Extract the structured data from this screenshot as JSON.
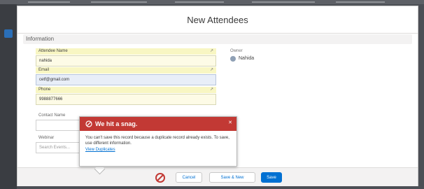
{
  "modal": {
    "title": "New Attendees"
  },
  "section": {
    "label": "Information"
  },
  "fields": [
    {
      "label": "Attendee Name",
      "value": "nahida"
    },
    {
      "label": "Email",
      "value": "cetf@gmail.com"
    },
    {
      "label": "Phone",
      "value": "9988877666"
    },
    {
      "label": "Contact Name",
      "value": ""
    },
    {
      "label": "Webinar",
      "value": "Search Events..."
    }
  ],
  "owner": {
    "label": "Owner",
    "value": "Nahida"
  },
  "popover": {
    "title": "We hit a snag.",
    "message": "You can't save this record because a duplicate record already exists. To save, use different information.",
    "link": "View Duplicates",
    "close_icon": "close-icon",
    "warning_icon": "warning-icon"
  },
  "footer": {
    "cancel_label": "Cancel",
    "save_new_label": "Save & New",
    "save_label": "Save"
  },
  "colors": {
    "error_red": "#c23934",
    "brand_blue": "#0070d2",
    "required_yellow": "#f8f6c3",
    "backdrop": "#4c4f55"
  }
}
